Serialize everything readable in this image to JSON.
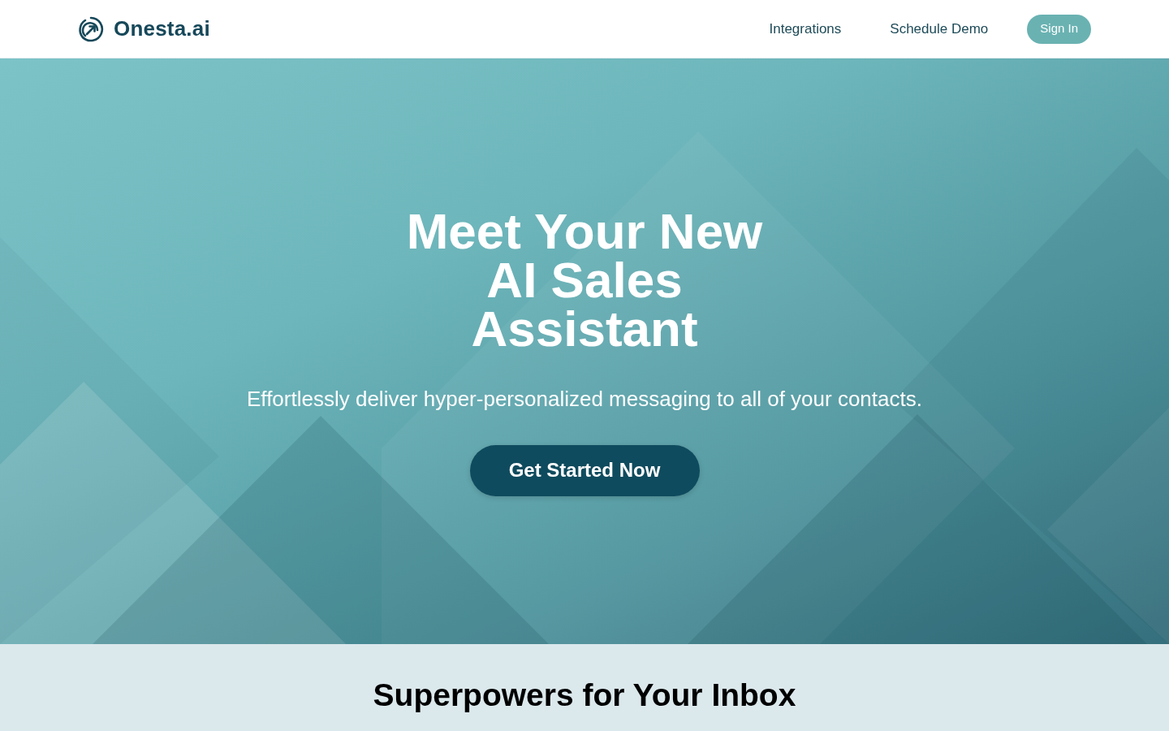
{
  "navbar": {
    "brand": "Onesta.ai",
    "links": [
      "Integrations",
      "Schedule Demo"
    ],
    "sign_in_button": "Sign In"
  },
  "hero": {
    "title_lines": [
      "Meet Your New",
      "AI Sales",
      "Assistant"
    ],
    "subtitle": "Effortlessly deliver hyper-personalized messaging to all of your contacts.",
    "cta_button": "Get Started Now"
  },
  "features": {
    "heading": "Superpowers for Your Inbox"
  }
}
